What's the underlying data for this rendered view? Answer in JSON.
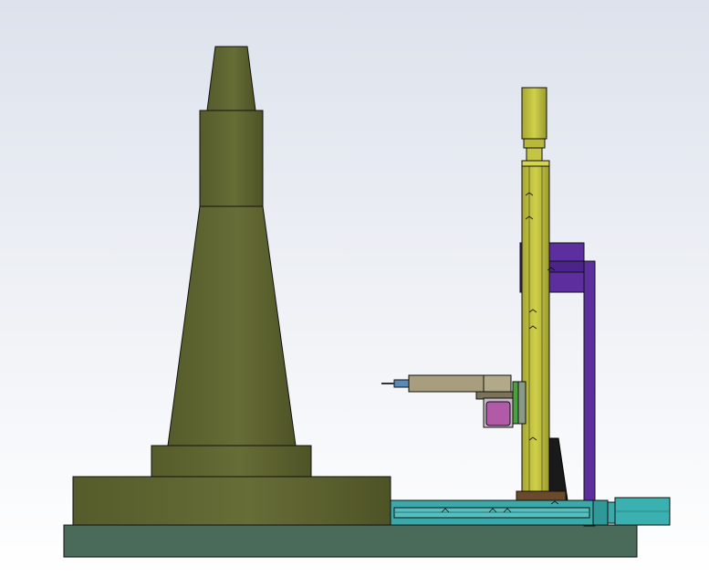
{
  "scene": {
    "background_top": "#dde2ec",
    "background_bottom": "#ffffff",
    "colors": {
      "olive": "#5c6230",
      "olive_light": "#6b7139",
      "olive_dark": "#454a22",
      "base_plate": "#4a6a5a",
      "yellow": "#b8b83c",
      "yellow_light": "#d4d450",
      "purple": "#5c2e9e",
      "purple_dark": "#3f1e73",
      "teal": "#3aa9a9",
      "teal_dark": "#1f7c7c",
      "tan": "#a89e7e",
      "magenta": "#b05aa8",
      "green": "#4aa040",
      "brown": "#6a4a2a",
      "black": "#1a1a1a",
      "blue_tool": "#5a8ab8"
    }
  }
}
